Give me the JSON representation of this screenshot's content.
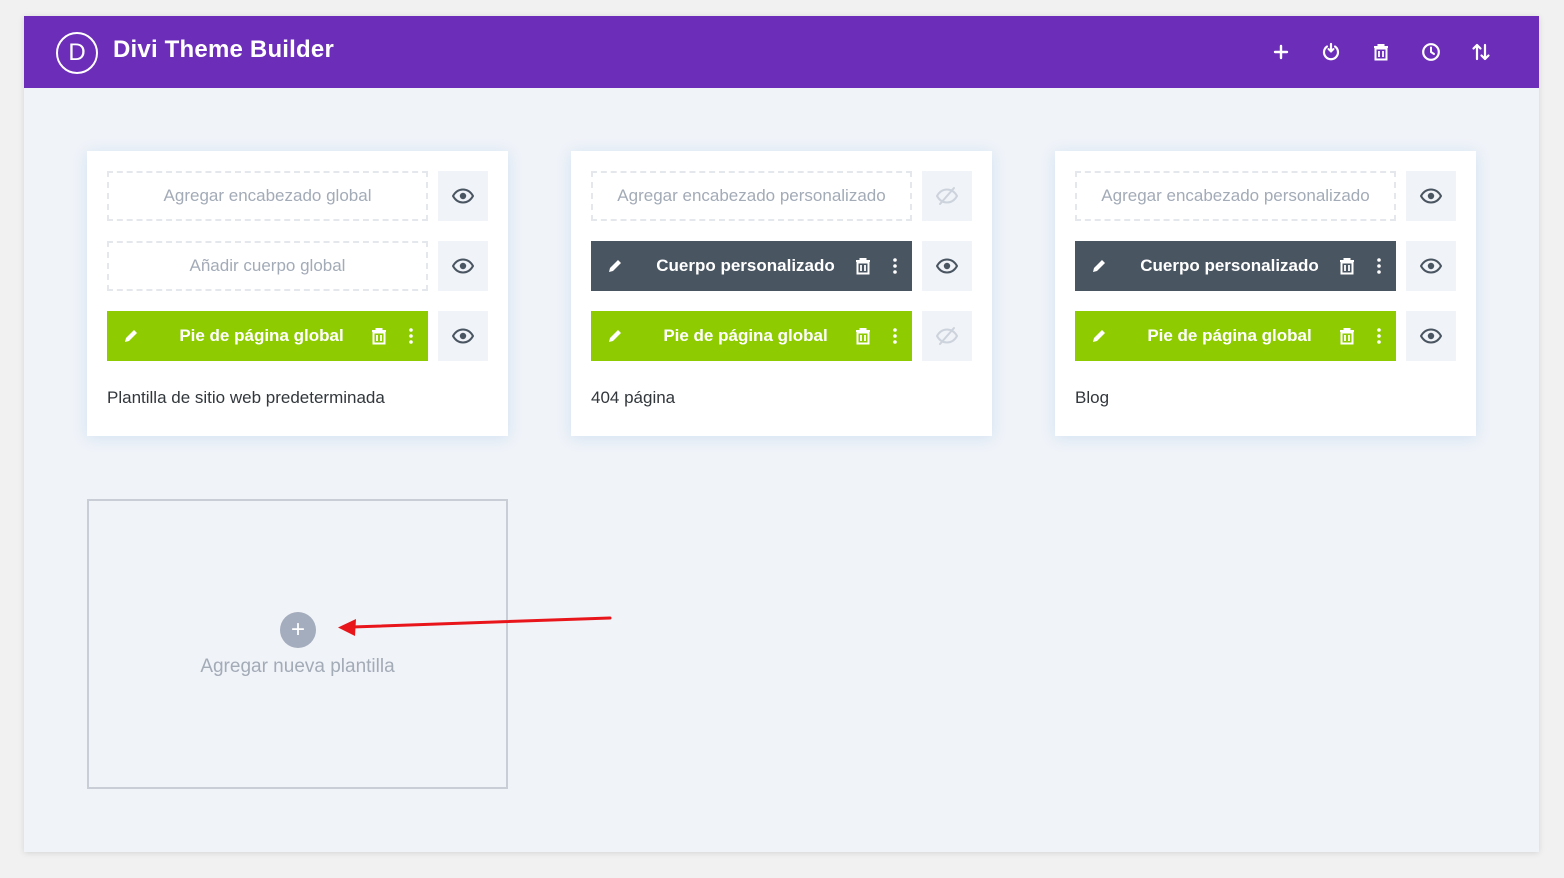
{
  "app": {
    "logo_letter": "D",
    "title": "Divi Theme Builder"
  },
  "toolbar": {
    "icons": [
      "plus-icon",
      "power-icon",
      "trash-icon",
      "history-icon",
      "sort-icon"
    ]
  },
  "templates": [
    {
      "name": "Plantilla de sitio web predeterminada",
      "header": {
        "label": "Agregar encabezado global",
        "state": "empty",
        "visible": true
      },
      "body": {
        "label": "Añadir cuerpo global",
        "state": "empty",
        "visible": true
      },
      "footer": {
        "label": "Pie de página global",
        "state": "filled",
        "visible": true
      }
    },
    {
      "name": "404 página",
      "header": {
        "label": "Agregar encabezado personalizado",
        "state": "empty",
        "visible": false
      },
      "body": {
        "label": "Cuerpo personalizado",
        "state": "filled",
        "visible": true
      },
      "footer": {
        "label": "Pie de página global",
        "state": "filled",
        "visible": false
      }
    },
    {
      "name": "Blog",
      "header": {
        "label": "Agregar encabezado personalizado",
        "state": "empty",
        "visible": true
      },
      "body": {
        "label": "Cuerpo personalizado",
        "state": "filled",
        "visible": true
      },
      "footer": {
        "label": "Pie de página global",
        "state": "filled",
        "visible": true
      }
    }
  ],
  "add_template": {
    "label": "Agregar nueva plantilla",
    "icon": "plus-icon"
  },
  "colors": {
    "brand": "#6c2eb9",
    "body_filled": "#4a5562",
    "footer_filled": "#8ecb00",
    "annotation_arrow": "#e8161b"
  }
}
